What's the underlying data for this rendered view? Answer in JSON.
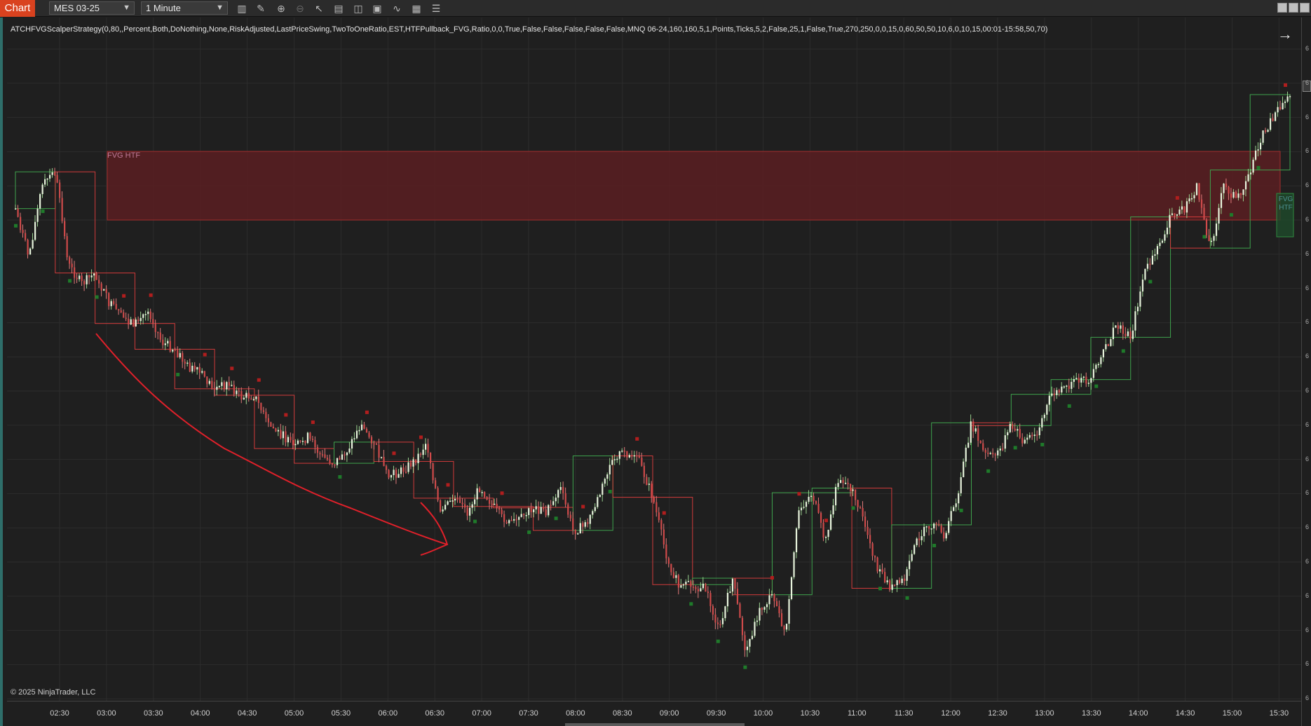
{
  "toolbar": {
    "chart_tab": "Chart",
    "instrument": "MES 03-25",
    "interval": "1 Minute"
  },
  "strategy_label": "ATCHFVGScalperStrategy(0,80,,Percent,Both,DoNothing,None,RiskAdjusted,LastPriceSwing,TwoToOneRatio,EST,HTFPullback_FVG,Ratio,0,0,True,False,False,False,False,False,MNQ 06-24,160,160,5,1,Points,Ticks,5,2,False,25,1,False,True,270,250,0,0,15,0,60,50,50,10,6,0,10,15,00:01-15:58,50,70)",
  "copyright": "© 2025 NinjaTrader, LLC",
  "fvg_label": "FVG HTF",
  "fvg_label_small": [
    "FVG",
    "HTF"
  ],
  "time_axis": [
    "02:30",
    "03:00",
    "03:30",
    "04:00",
    "04:30",
    "05:00",
    "05:30",
    "06:00",
    "06:30",
    "07:00",
    "07:30",
    "08:00",
    "08:30",
    "09:00",
    "09:30",
    "10:00",
    "10:30",
    "11:00",
    "11:30",
    "12:00",
    "12:30",
    "13:00",
    "13:30",
    "14:00",
    "14:30",
    "15:00",
    "15:30"
  ],
  "price_axis_ticks": [
    "6",
    "6",
    "6",
    "6",
    "6",
    "6",
    "6",
    "6",
    "6",
    "6",
    "6",
    "6",
    "6",
    "6",
    "6",
    "6",
    "6",
    "6",
    "6",
    "6"
  ],
  "colors": {
    "background": "#1f1f1f",
    "up": "#3fa34d",
    "down": "#d23b3b",
    "fvg_fill": "#5a1e22",
    "fvg_border": "#a02c2c",
    "annotation": "#e0202a"
  },
  "price_path": [
    0.0,
    -5.2,
    2.5,
    4.0,
    -6.1,
    -8.2,
    -7.0,
    -10.2,
    -11.8,
    -12.5,
    -11.0,
    -14.5,
    -15.3,
    -17.2,
    -18.0,
    -19.6,
    -19.0,
    -20.5,
    -20.3,
    -23.5,
    -24.5,
    -26.1,
    -24.8,
    -26.9,
    -27.7,
    -26.2,
    -23.5,
    -25.4,
    -29.2,
    -28.6,
    -27.5,
    -25.6,
    -33.3,
    -31.5,
    -33.1,
    -30.2,
    -32.4,
    -34.4,
    -33.8,
    -32.5,
    -33.0,
    -30.2,
    -35.0,
    -34.5,
    -31.1,
    -26.9,
    -26.5,
    -27.6,
    -31.4,
    -37.6,
    -41.3,
    -40.9,
    -41.4,
    -46.1,
    -40.2,
    -48.2,
    -43.8,
    -42.0,
    -46.5,
    -32.8,
    -30.9,
    -36.4,
    -29.1,
    -30.4,
    -34.5,
    -39.5,
    -41.3,
    -40.3,
    -35.7,
    -34.4,
    -35.5,
    -31.0,
    -23.3,
    -26.8,
    -26.7,
    -23.6,
    -25.3,
    -24.6,
    -20.2,
    -19.7,
    -18.8,
    -18.6,
    -15.4,
    -12.5,
    -14.0,
    -7.0,
    -4.6,
    -0.9,
    -0.1,
    2.4,
    -4.3,
    2.5,
    1.0,
    4.2,
    8.2,
    10.7,
    12.4
  ]
}
